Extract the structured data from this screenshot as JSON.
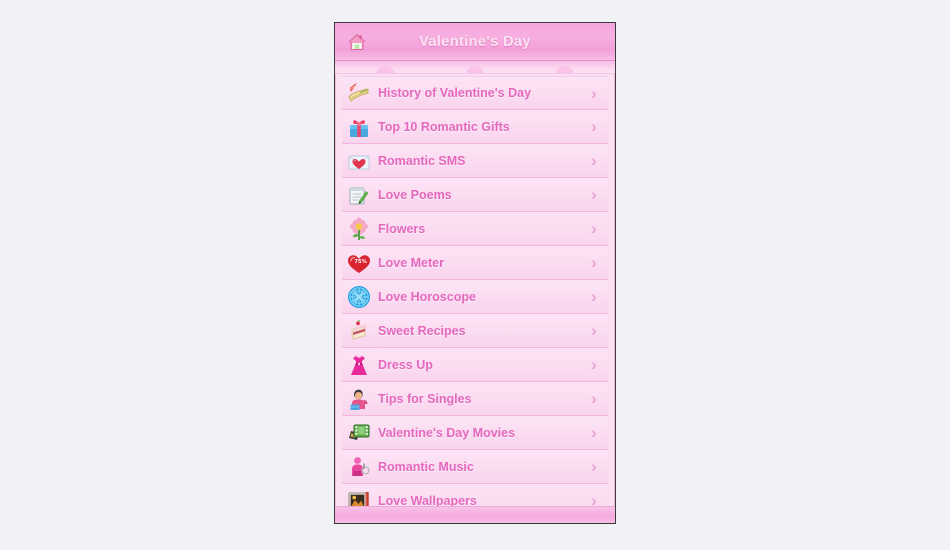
{
  "page": {
    "background_color": "#f0f2f5"
  },
  "app": {
    "panel_border_color": "#3a3a3a",
    "accent_color": "#e468bd",
    "header_color": "#f4a6dd",
    "row_background": "#fbdcf1",
    "header": {
      "title": "Valentine's Day",
      "home_icon": "home-icon"
    },
    "footer": {
      "label": ""
    },
    "menu": {
      "chevron_glyph": "›",
      "items": [
        {
          "label": "History of Valentine's Day",
          "icon": "scroll-quill-icon"
        },
        {
          "label": "Top 10 Romantic Gifts",
          "icon": "gift-box-icon"
        },
        {
          "label": "Romantic SMS",
          "icon": "heart-envelope-icon"
        },
        {
          "label": "Love Poems",
          "icon": "notepad-pen-icon"
        },
        {
          "label": "Flowers",
          "icon": "flower-icon"
        },
        {
          "label": "Love Meter",
          "icon": "heart-percent-icon",
          "badge": "75%"
        },
        {
          "label": "Love Horoscope",
          "icon": "zodiac-wheel-icon"
        },
        {
          "label": "Sweet Recipes",
          "icon": "cake-slice-icon"
        },
        {
          "label": "Dress Up",
          "icon": "dress-icon"
        },
        {
          "label": "Tips for Singles",
          "icon": "person-icon"
        },
        {
          "label": "Valentine's Day Movies",
          "icon": "film-reel-icon"
        },
        {
          "label": "Romantic Music",
          "icon": "music-figure-icon"
        },
        {
          "label": "Love Wallpapers",
          "icon": "picture-frame-icon"
        }
      ]
    }
  }
}
